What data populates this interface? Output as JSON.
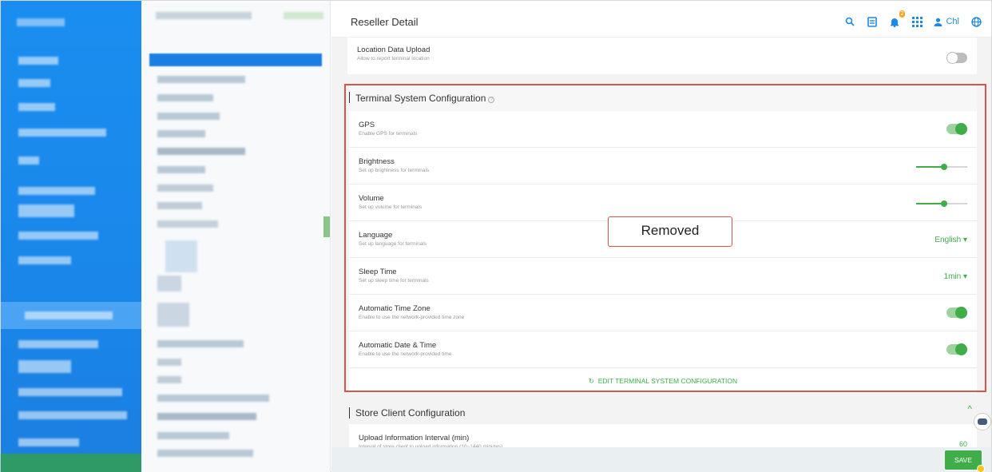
{
  "header": {
    "title": "Reseller Detail",
    "notification_count": "2",
    "user_name": "Chl",
    "icons": [
      "search-icon",
      "document-icon",
      "bell-icon",
      "apps-grid-icon",
      "user-icon",
      "globe-icon"
    ],
    "accent_color": "#1e88e5"
  },
  "location_upload": {
    "title": "Location Data Upload",
    "desc": "Allow to report terminal location",
    "enabled": false
  },
  "terminal_config": {
    "heading": "Terminal System Configuration",
    "help_glyph": "?",
    "rows": [
      {
        "title": "GPS",
        "desc": "Enable GPS for terminals",
        "control": "toggle",
        "enabled": true
      },
      {
        "title": "Brightness",
        "desc": "Set up brightness for terminals",
        "control": "slider",
        "level": 0.55
      },
      {
        "title": "Volume",
        "desc": "Set up volume for terminals",
        "control": "slider",
        "level": 0.55
      },
      {
        "title": "Language",
        "desc": "Set up language for terminals",
        "control": "dropdown",
        "value": "English ▾"
      },
      {
        "title": "Sleep Time",
        "desc": "Set up sleep time for terminals",
        "control": "dropdown",
        "value": "1min ▾"
      },
      {
        "title": "Automatic Time Zone",
        "desc": "Enable to use the network-provided time zone",
        "control": "toggle",
        "enabled": true
      },
      {
        "title": "Automatic Date & Time",
        "desc": "Enable to use the network-provided time",
        "control": "toggle",
        "enabled": true
      }
    ],
    "edit_label": "EDIT TERMINAL SYSTEM CONFIGURATION",
    "edit_icon": "↻"
  },
  "annotation": {
    "removed_label": "Removed",
    "color": "#d9534f"
  },
  "store_config": {
    "heading": "Store Client Configuration",
    "caret": "^",
    "row_title": "Upload Information Interval (min)",
    "row_desc": "Interval of store client to upload information (10~1440 minutes)",
    "row_value": "60"
  },
  "footer": {
    "save_label": "SAVE"
  },
  "colors": {
    "success": "#3fae49",
    "nav": "#1a86ea"
  }
}
